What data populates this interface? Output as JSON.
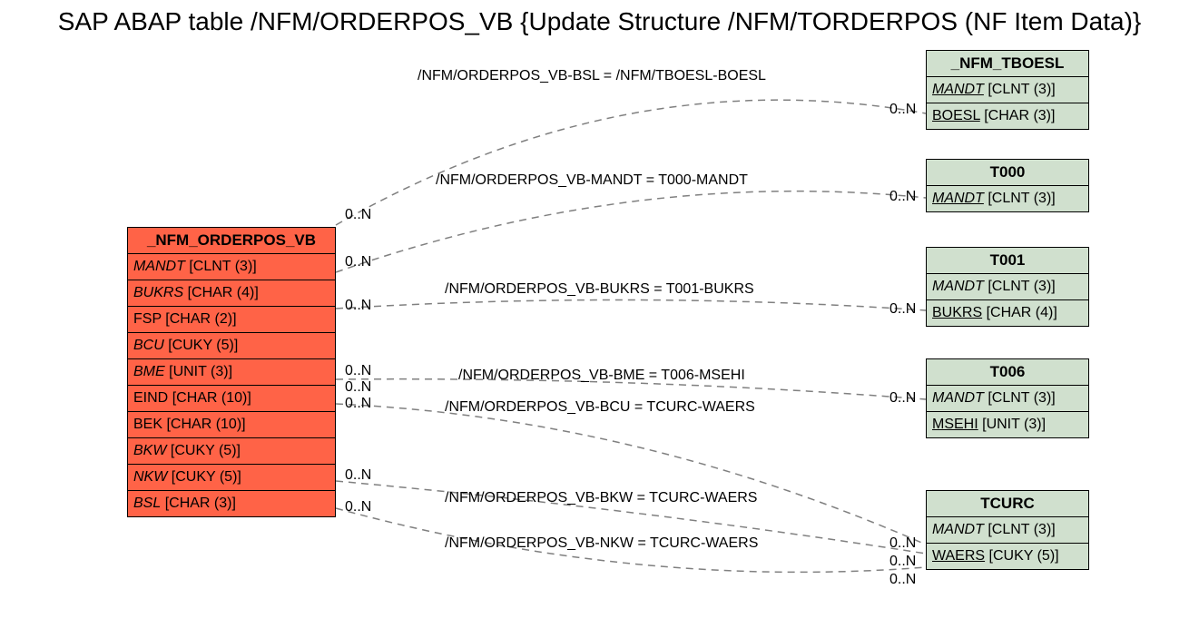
{
  "title": "SAP ABAP table /NFM/ORDERPOS_VB {Update Structure /NFM/TORDERPOS (NF Item Data)}",
  "main_entity": {
    "name": "_NFM_ORDERPOS_VB",
    "fields": [
      {
        "name": "MANDT",
        "type": "[CLNT (3)]",
        "italic": true
      },
      {
        "name": "BUKRS",
        "type": "[CHAR (4)]",
        "italic": true
      },
      {
        "name": "FSP",
        "type": "[CHAR (2)]",
        "italic": false
      },
      {
        "name": "BCU",
        "type": "[CUKY (5)]",
        "italic": true
      },
      {
        "name": "BME",
        "type": "[UNIT (3)]",
        "italic": true
      },
      {
        "name": "EIND",
        "type": "[CHAR (10)]",
        "italic": false
      },
      {
        "name": "BEK",
        "type": "[CHAR (10)]",
        "italic": false
      },
      {
        "name": "BKW",
        "type": "[CUKY (5)]",
        "italic": true
      },
      {
        "name": "NKW",
        "type": "[CUKY (5)]",
        "italic": true
      },
      {
        "name": "BSL",
        "type": "[CHAR (3)]",
        "italic": true
      }
    ]
  },
  "ref_entities": [
    {
      "id": "tboesl",
      "name": "_NFM_TBOESL",
      "fields": [
        {
          "name": "MANDT",
          "type": "[CLNT (3)]",
          "italic": true,
          "underline": true
        },
        {
          "name": "BOESL",
          "type": "[CHAR (3)]",
          "italic": false,
          "underline": true
        }
      ]
    },
    {
      "id": "t000",
      "name": "T000",
      "fields": [
        {
          "name": "MANDT",
          "type": "[CLNT (3)]",
          "italic": true,
          "underline": true
        }
      ]
    },
    {
      "id": "t001",
      "name": "T001",
      "fields": [
        {
          "name": "MANDT",
          "type": "[CLNT (3)]",
          "italic": true,
          "underline": false
        },
        {
          "name": "BUKRS",
          "type": "[CHAR (4)]",
          "italic": false,
          "underline": true
        }
      ]
    },
    {
      "id": "t006",
      "name": "T006",
      "fields": [
        {
          "name": "MANDT",
          "type": "[CLNT (3)]",
          "italic": true,
          "underline": false
        },
        {
          "name": "MSEHI",
          "type": "[UNIT (3)]",
          "italic": false,
          "underline": true
        }
      ]
    },
    {
      "id": "tcurc",
      "name": "TCURC",
      "fields": [
        {
          "name": "MANDT",
          "type": "[CLNT (3)]",
          "italic": true,
          "underline": false
        },
        {
          "name": "WAERS",
          "type": "[CUKY (5)]",
          "italic": false,
          "underline": true
        }
      ]
    }
  ],
  "relationships": [
    {
      "label": "/NFM/ORDERPOS_VB-BSL = /NFM/TBOESL-BOESL",
      "left_card": "0..N",
      "right_card": "0..N"
    },
    {
      "label": "/NFM/ORDERPOS_VB-MANDT = T000-MANDT",
      "left_card": "0..N",
      "right_card": "0..N"
    },
    {
      "label": "/NFM/ORDERPOS_VB-BUKRS = T001-BUKRS",
      "left_card": "0..N",
      "right_card": "0..N"
    },
    {
      "label": "/NFM/ORDERPOS_VB-BME = T006-MSEHI",
      "left_card": "0..N",
      "right_card": "0..N"
    },
    {
      "label": "/NFM/ORDERPOS_VB-BCU = TCURC-WAERS",
      "left_card": "0..N",
      "right_card": "0..N"
    },
    {
      "label": "/NFM/ORDERPOS_VB-BKW = TCURC-WAERS",
      "left_card": "0..N",
      "right_card": "0..N"
    },
    {
      "label": "/NFM/ORDERPOS_VB-NKW = TCURC-WAERS",
      "left_card": "0..N",
      "right_card": "0..N"
    }
  ],
  "cards_extra": {
    "tcurc_extra": "0..N"
  }
}
